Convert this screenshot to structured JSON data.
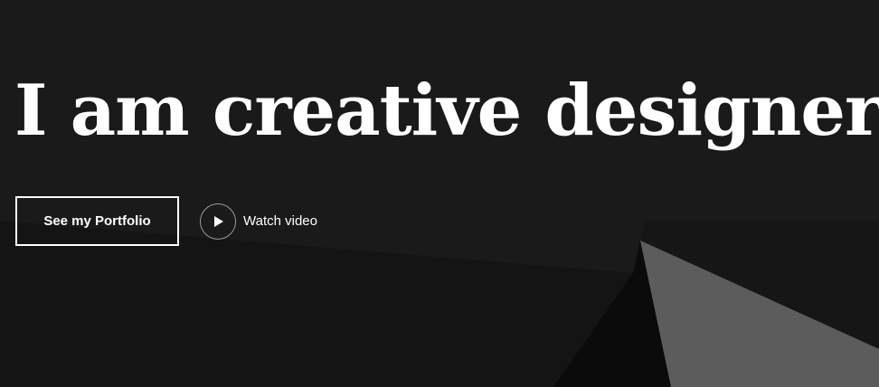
{
  "hero": {
    "headline": "I am creative designer",
    "primary_button_label": "See my Portfolio",
    "secondary_link_label": "Watch video",
    "secondary_link_icon": "play-icon"
  },
  "colors": {
    "background": "#1a1a1a",
    "text": "#ffffff",
    "accent_shape": "#5c5c5c"
  }
}
